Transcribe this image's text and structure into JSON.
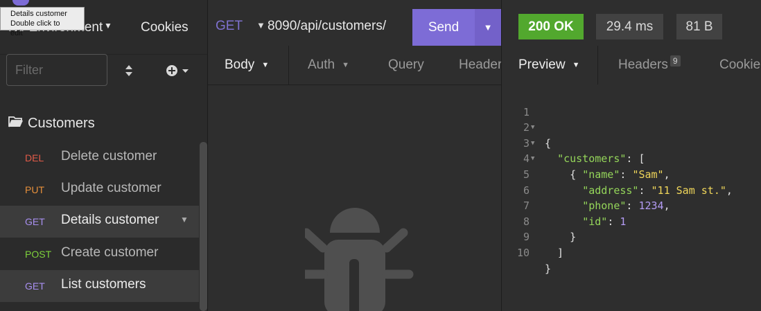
{
  "sidebar": {
    "environment": "No Environment",
    "cookies_label": "Cookies",
    "filter_placeholder": "Filter",
    "folder_name": "Customers",
    "requests": [
      {
        "method": "DEL",
        "method_color": "#e25b49",
        "name": "Delete customer",
        "selected": false
      },
      {
        "method": "PUT",
        "method_color": "#e8903b",
        "name": "Update customer",
        "selected": false
      },
      {
        "method": "GET",
        "method_color": "#a88ff0",
        "name": "Details customer",
        "selected": true
      },
      {
        "method": "POST",
        "method_color": "#7ed23b",
        "name": "Create customer",
        "selected": false
      },
      {
        "method": "GET",
        "method_color": "#a88ff0",
        "name": "List customers",
        "selected": true
      }
    ],
    "tooltip": {
      "line1": "Details customer",
      "line2": "Double click to edit"
    }
  },
  "request": {
    "method": "GET",
    "url": "8090/api/customers/",
    "send_label": "Send",
    "tabs": [
      "Body",
      "Auth",
      "Query",
      "Header"
    ]
  },
  "response": {
    "status": "200 OK",
    "time": "29.4 ms",
    "size": "81 B",
    "tabs": [
      "Preview",
      "Headers",
      "Cookie"
    ],
    "headers_count": "9",
    "code_lines": [
      "1",
      "2",
      "3",
      "4",
      "5",
      "6",
      "7",
      "8",
      "9",
      "10"
    ],
    "json": {
      "key_customers": "\"customers\"",
      "key_name": "\"name\"",
      "val_name": "\"Sam\"",
      "key_address": "\"address\"",
      "val_address": "\"11 Sam st.\"",
      "key_phone": "\"phone\"",
      "val_phone": "1234",
      "key_id": "\"id\"",
      "val_id": "1"
    }
  },
  "colors": {
    "accent": "#7d6cd6",
    "status_ok": "#52a82e",
    "json_key": "#95d65a",
    "json_string": "#f0d65a",
    "json_number": "#b49cf5"
  }
}
